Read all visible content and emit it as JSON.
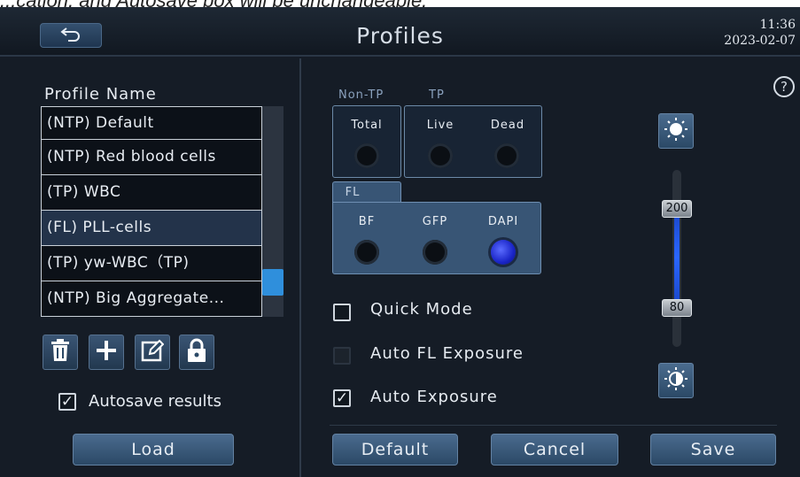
{
  "caption": "...cation, and Autosave box will be unchangeable.",
  "header": {
    "title": "Profiles",
    "time": "11:36",
    "date": "2023-02-07"
  },
  "profiles": {
    "label": "Profile Name",
    "items": [
      {
        "label": "(NTP) Default"
      },
      {
        "label": "(NTP) Red blood cells"
      },
      {
        "label": "(TP) WBC"
      },
      {
        "label": "(FL) PLL-cells"
      },
      {
        "label": "(TP) yw-WBC（TP)"
      },
      {
        "label": "(NTP) Big Aggregate..."
      }
    ],
    "selected_index": 3,
    "autosave_label": "Autosave results",
    "autosave_checked": true,
    "load_label": "Load"
  },
  "settings": {
    "non_tp_label": "Non-TP",
    "tp_label": "TP",
    "fl_label": "FL",
    "options": {
      "total": "Total",
      "live": "Live",
      "dead": "Dead",
      "bf": "BF",
      "gfp": "GFP",
      "dapi": "DAPI"
    },
    "quick_mode_label": "Quick Mode",
    "auto_fl_label": "Auto FL Exposure",
    "auto_exposure_label": "Auto Exposure",
    "slider_high": "200",
    "slider_low": "80",
    "help": "?"
  },
  "actions": {
    "default_label": "Default",
    "cancel_label": "Cancel",
    "save_label": "Save"
  },
  "colors": {
    "accent": "#2f8fdc",
    "selected_led": "#1a25c8"
  }
}
